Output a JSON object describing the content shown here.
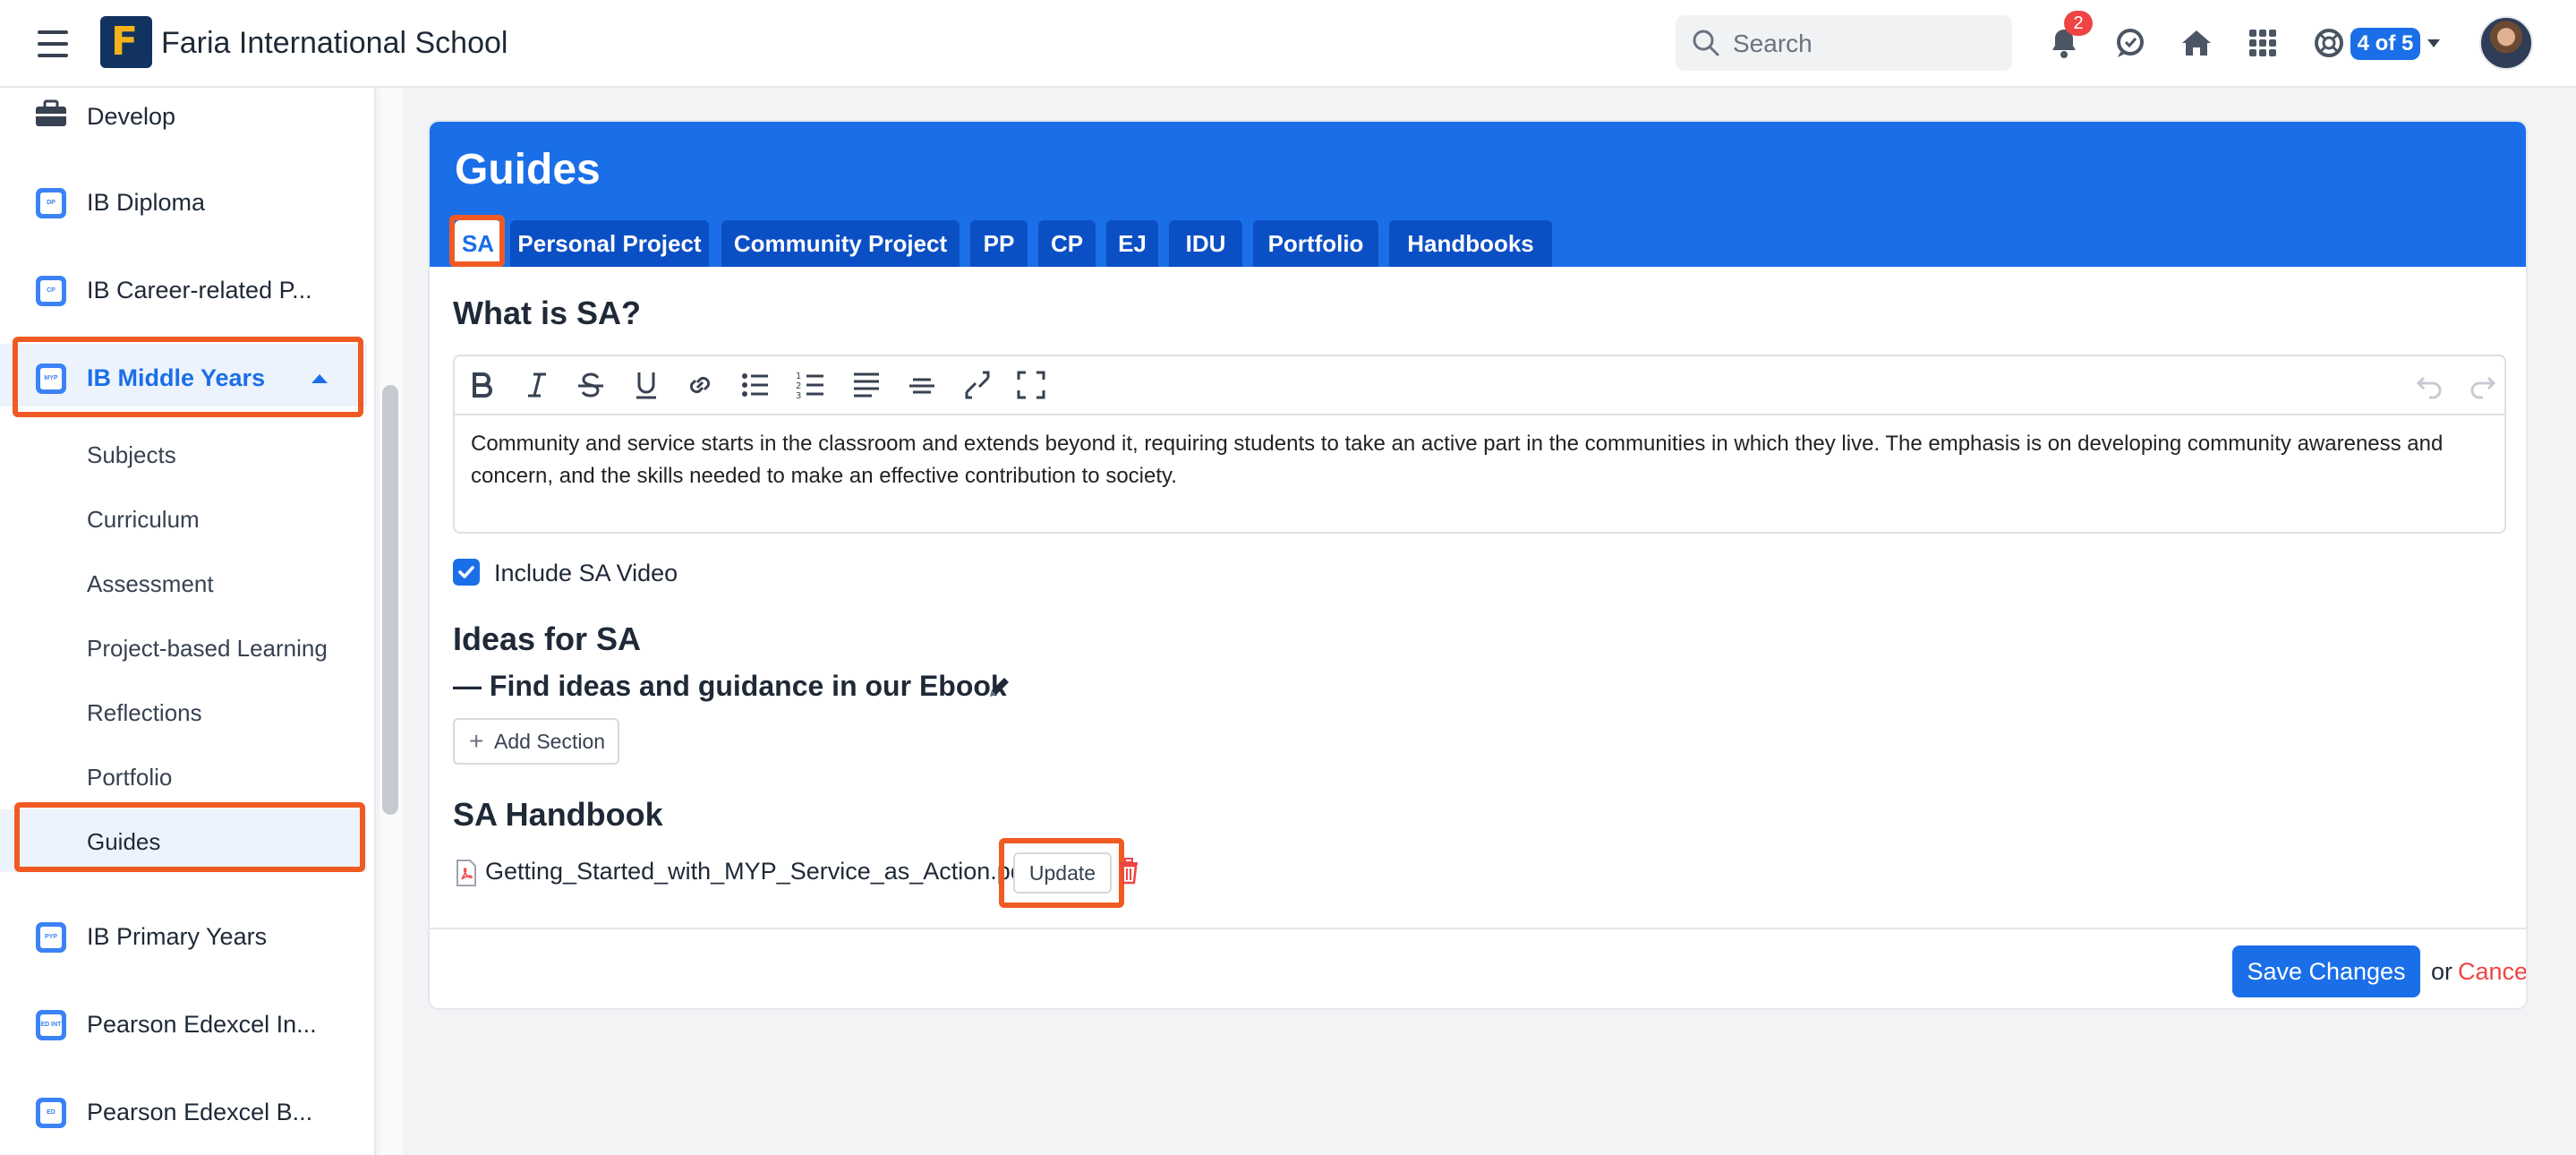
{
  "header": {
    "app_title": "Faria International School",
    "search_placeholder": "Search",
    "notifications_count": "2",
    "pager": "4 of 5"
  },
  "sidebar": {
    "items": [
      {
        "label": "Develop",
        "icon": "briefcase-icon"
      },
      {
        "label": "IB Diploma",
        "icon_text": "DP"
      },
      {
        "label": "IB Career-related P...",
        "icon_text": "CP"
      },
      {
        "label": "IB Middle Years",
        "icon_text": "MYP",
        "active": true
      },
      {
        "label": "IB Primary Years",
        "icon_text": "PYP"
      },
      {
        "label": "Pearson Edexcel In...",
        "icon_text": "ED INT"
      },
      {
        "label": "Pearson Edexcel B...",
        "icon_text": "ED"
      }
    ],
    "sub_items": [
      "Subjects",
      "Curriculum",
      "Assessment",
      "Project-based Learning",
      "Reflections",
      "Portfolio",
      "Guides"
    ],
    "selected_sub": "Guides"
  },
  "main": {
    "title": "Guides",
    "tabs": [
      "SA",
      "Personal Project",
      "Community Project",
      "PP",
      "CP",
      "EJ",
      "IDU",
      "Portfolio",
      "Handbooks"
    ],
    "active_tab": "SA",
    "what_heading": "What is SA?",
    "editor_text": "Community and service starts in the classroom and extends beyond it, requiring students to take an active part in the communities in which they live. The emphasis is on developing community awareness and concern, and the skills needed to make an effective contribution to society.",
    "include_video_label": "Include SA Video",
    "include_video_checked": true,
    "ideas_heading": "Ideas for SA",
    "ideas_line": "— Find ideas and guidance in our Ebook",
    "add_section_label": "Add Section",
    "handbook_heading": "SA Handbook",
    "handbook_file": "Getting_Started_with_MYP_Service_as_Action.pdf",
    "update_label": "Update",
    "save_label": "Save Changes",
    "or_text": "or",
    "cancel_label": "Cancel"
  },
  "colors": {
    "accent": "#1a6fe8",
    "tab_bg": "#0b4fc4",
    "highlight": "#f05a22",
    "danger": "#ef4444"
  }
}
